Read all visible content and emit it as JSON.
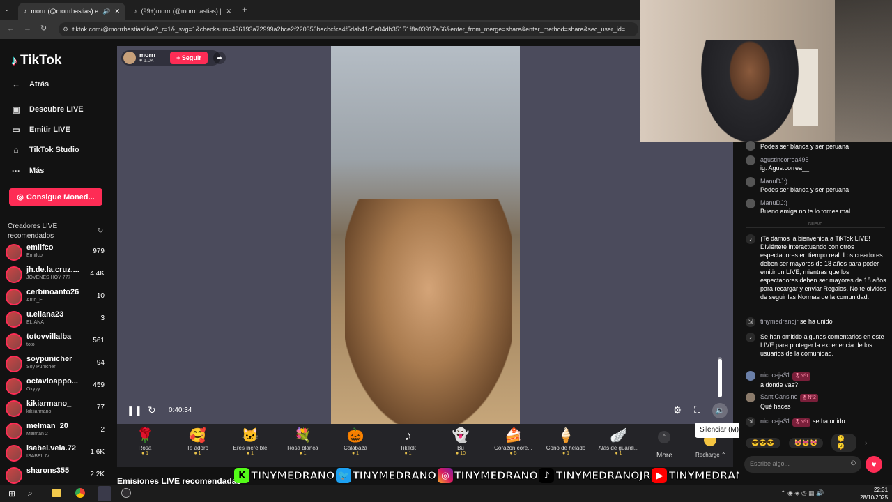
{
  "browser": {
    "tabs": [
      {
        "label": "morrr (@morrrbastias) está"
      },
      {
        "label": "(99+)morrr (@morrrbastias) | T"
      }
    ],
    "url": "tiktok.com/@morrrbastias/live?_r=1&_svg=1&checksum=496193a72999a2bce2f220356bacbcfce4f5dab41c5e04db35151f8a03917a66&enter_from_merge=share&enter_method=share&sec_user_id="
  },
  "sidebar": {
    "logo": "TikTok",
    "back": "Atrás",
    "nav": [
      {
        "label": "Descubre LIVE",
        "icon": "live-tv-icon"
      },
      {
        "label": "Emitir LIVE",
        "icon": "video-camera-icon"
      },
      {
        "label": "TikTok Studio",
        "icon": "home-icon"
      },
      {
        "label": "Más",
        "icon": "more-dots-icon"
      }
    ],
    "coins_button": "Consigue Moned...",
    "recommended_title": "Creadores LIVE recomendados",
    "creators": [
      {
        "name": "emiifco",
        "sub": "Emiifco",
        "count": "979"
      },
      {
        "name": "jh.de.la.cruz....",
        "sub": "JÓVENES HOY 777",
        "count": "4.4K"
      },
      {
        "name": "cerbinoanto26",
        "sub": "Anto_E",
        "count": "10"
      },
      {
        "name": "u.eliana23",
        "sub": "ELIANA",
        "count": "3"
      },
      {
        "name": "totovvillalba",
        "sub": "toto",
        "count": "561"
      },
      {
        "name": "soypunicher",
        "sub": "Soy Punicher",
        "count": "94"
      },
      {
        "name": "octavioappo...",
        "sub": "Okyyy",
        "count": "459"
      },
      {
        "name": "kikiarmano_",
        "sub": "kikiiarmano",
        "count": "77"
      },
      {
        "name": "melman_20",
        "sub": "Melman 2",
        "count": "2"
      },
      {
        "name": "isabel.vela.72",
        "sub": "ISABEL IV",
        "count": "1.6K"
      },
      {
        "name": "sharons355",
        "sub": "",
        "count": "2.2K"
      }
    ]
  },
  "player": {
    "host_name": "morrr",
    "host_likes": "1.0K",
    "follow_button": "+ Seguir",
    "time": "0:40:34",
    "mute_tooltip": "Silenciar (M)",
    "volume_level": 0.95
  },
  "gifts": [
    {
      "name": "Rosa",
      "price": "1",
      "icon": "🌹"
    },
    {
      "name": "Te adoro",
      "price": "1",
      "icon": "🥰"
    },
    {
      "name": "Eres increíble",
      "price": "1",
      "icon": "🐱"
    },
    {
      "name": "Rosa blanca",
      "price": "1",
      "icon": "💐"
    },
    {
      "name": "Calabaza",
      "price": "1",
      "icon": "🎃"
    },
    {
      "name": "TikTok",
      "price": "1",
      "icon": "♪"
    },
    {
      "name": "Bu",
      "price": "10",
      "icon": "👻"
    },
    {
      "name": "Corazón core...",
      "price": "5",
      "icon": "🍰"
    },
    {
      "name": "Cono de helado",
      "price": "1",
      "icon": "🍦"
    },
    {
      "name": "Alas de guardi...",
      "price": "1",
      "icon": "🪽"
    }
  ],
  "gifts_more": "More",
  "recharge": "Recharge",
  "recommended_live": "Emisiones LIVE recomendadas",
  "chat": {
    "messages": [
      {
        "user": "",
        "text": "Podes ser blanca y ser peruana"
      },
      {
        "user": "agustincorrea495",
        "text": "ig: Agus.correa__"
      },
      {
        "user": "ManuDJ:)",
        "text": "Podes ser blanca y ser peruana"
      },
      {
        "user": "ManuDJ:)",
        "text": "Bueno amiga no te lo tomes mal"
      }
    ],
    "divider": "Nuevo",
    "welcome": "¡Te damos la bienvenida a TikTok LIVE! Diviértete interactuando con otros espectadores en tiempo real. Los creadores deben ser mayores de 18 años para poder emitir un LIVE, mientras que los espectadores deben ser mayores de 18 años para recargar y enviar Regalos. No te olvides de seguir las Normas de la comunidad.",
    "join1_user": "tinymedranojr",
    "join1_text": "se ha unido",
    "omitted": "Se han omitido algunos comentarios en este LIVE para proteger la experiencia de los usuarios de la comunidad.",
    "msg5_user": "nicoceja$1",
    "msg5_badge": "Nº1",
    "msg5_text": "a donde vas?",
    "msg6_user": "SantiCansino",
    "msg6_badge": "Nº2",
    "msg6_text": "Qué haces",
    "join2_user": "nicoceja$1",
    "join2_badge": "Nº1",
    "join2_text": "se ha unido",
    "quick_emojis": [
      "😎😎😎",
      "😻😻😻",
      "🫠🫠"
    ],
    "input_placeholder": "Escribe algo..."
  },
  "overlay": {
    "kick": "TINYMEDRANO",
    "twitter": "TINYMEDRANO",
    "instagram": "TINYMEDRANO",
    "tiktok": "TINYMEDRANOJR",
    "youtube": "TINYMEDRANO"
  },
  "taskbar": {
    "time": "22:31",
    "date": "28/10/2025"
  }
}
